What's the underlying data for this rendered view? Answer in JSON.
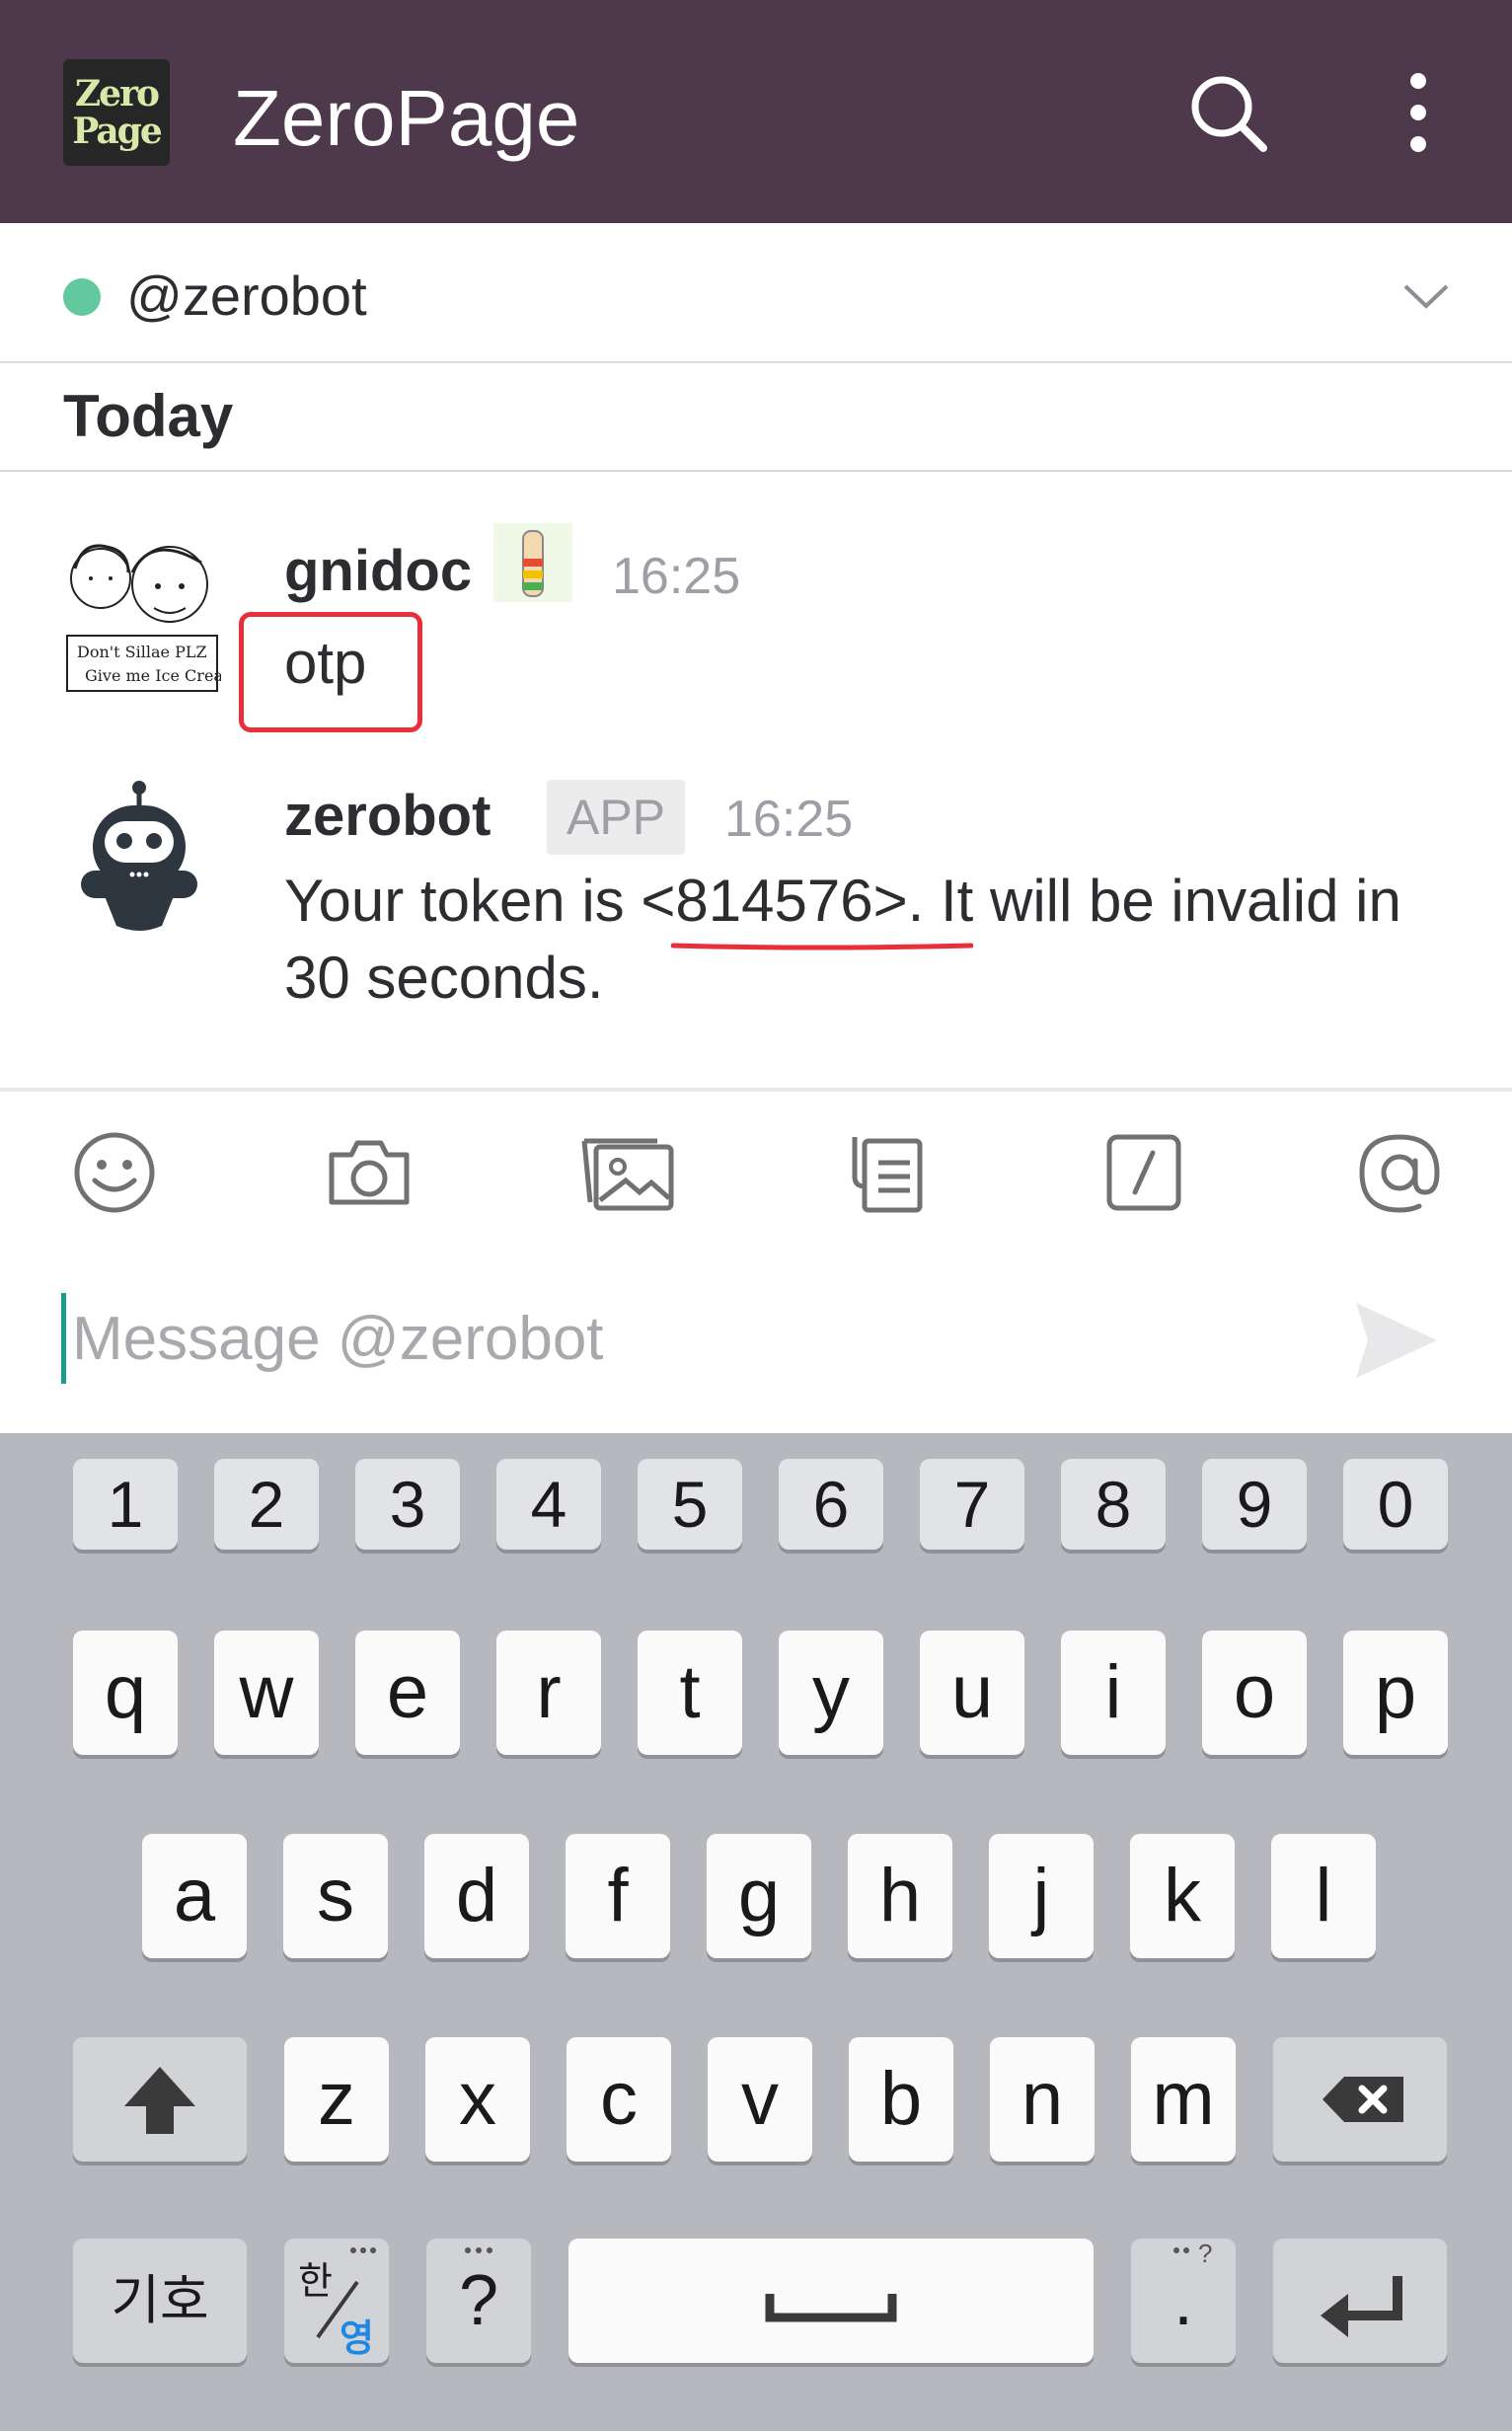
{
  "app": {
    "title": "ZeroPage",
    "logo_text": [
      "Zero",
      "Page"
    ]
  },
  "channel": {
    "name": "@zerobot",
    "presence": "online"
  },
  "day_divider": "Today",
  "messages": [
    {
      "author": "gnidoc",
      "time": "16:25",
      "text": "otp",
      "avatar_caption": [
        "Don't Sillae PLZ",
        "Give me Ice Cream"
      ]
    },
    {
      "author": "zerobot",
      "badge": "APP",
      "time": "16:25",
      "text": "Your token is <814576>. It will be invalid in 30 seconds."
    }
  ],
  "composer": {
    "placeholder": "Message @zerobot",
    "tools": [
      "emoji-icon",
      "camera-icon",
      "gallery-icon",
      "files-icon",
      "slash-command-icon",
      "mention-icon"
    ]
  },
  "keyboard": {
    "number_row": [
      "1",
      "2",
      "3",
      "4",
      "5",
      "6",
      "7",
      "8",
      "9",
      "0"
    ],
    "row1": [
      "q",
      "w",
      "e",
      "r",
      "t",
      "y",
      "u",
      "i",
      "o",
      "p"
    ],
    "row2": [
      "a",
      "s",
      "d",
      "f",
      "g",
      "h",
      "j",
      "k",
      "l"
    ],
    "row3": [
      "z",
      "x",
      "c",
      "v",
      "b",
      "n",
      "m"
    ],
    "symbols_label": "기호",
    "lang_top": "한",
    "lang_bottom": "영",
    "question_label": "?",
    "period_label": "."
  },
  "colors": {
    "header_bg": "#4d394b",
    "presence": "#2eb67d",
    "highlight": "#e8303a",
    "cursor": "#1d9b8c",
    "keyboard_bg": "#b6b8bd"
  }
}
